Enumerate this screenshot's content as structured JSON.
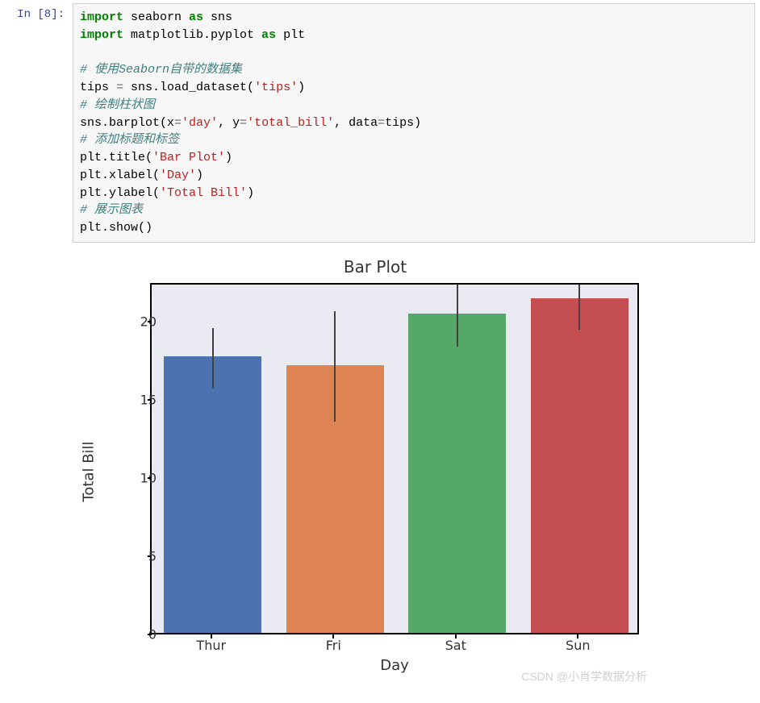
{
  "prompt": "In [8]:",
  "code": {
    "l1a": "import",
    "l1b": " seaborn ",
    "l1c": "as",
    "l1d": " sns",
    "l2a": "import",
    "l2b": " matplotlib.pyplot ",
    "l2c": "as",
    "l2d": " plt",
    "l4": "# 使用Seaborn自带的数据集",
    "l5a": "tips ",
    "l5b": "=",
    "l5c": " sns.load_dataset(",
    "l5d": "'tips'",
    "l5e": ")",
    "l6": "# 绘制柱状图",
    "l7a": "sns.barplot(x",
    "l7b": "=",
    "l7c": "'day'",
    "l7d": ", y",
    "l7e": "=",
    "l7f": "'total_bill'",
    "l7g": ", data",
    "l7h": "=",
    "l7i": "tips)",
    "l8": "# 添加标题和标签",
    "l9a": "plt.title(",
    "l9b": "'Bar Plot'",
    "l9c": ")",
    "l10a": "plt.xlabel(",
    "l10b": "'Day'",
    "l10c": ")",
    "l11a": "plt.ylabel(",
    "l11b": "'Total Bill'",
    "l11c": ")",
    "l12": "# 展示图表",
    "l13": "plt.show()"
  },
  "chart_data": {
    "type": "bar",
    "title": "Bar Plot",
    "xlabel": "Day",
    "ylabel": "Total Bill",
    "ylim": [
      0,
      22.5
    ],
    "yticks": [
      0,
      5,
      10,
      15,
      20
    ],
    "categories": [
      "Thur",
      "Fri",
      "Sat",
      "Sun"
    ],
    "values": [
      17.7,
      17.1,
      20.4,
      21.4
    ],
    "error_low": [
      15.9,
      13.7,
      18.5,
      19.6
    ],
    "error_high": [
      19.7,
      20.8,
      22.5,
      23.5
    ],
    "colors": [
      "#4c72b0",
      "#dd8452",
      "#55a868",
      "#c44e52"
    ]
  },
  "watermark": "CSDN @小肖学数据分析"
}
